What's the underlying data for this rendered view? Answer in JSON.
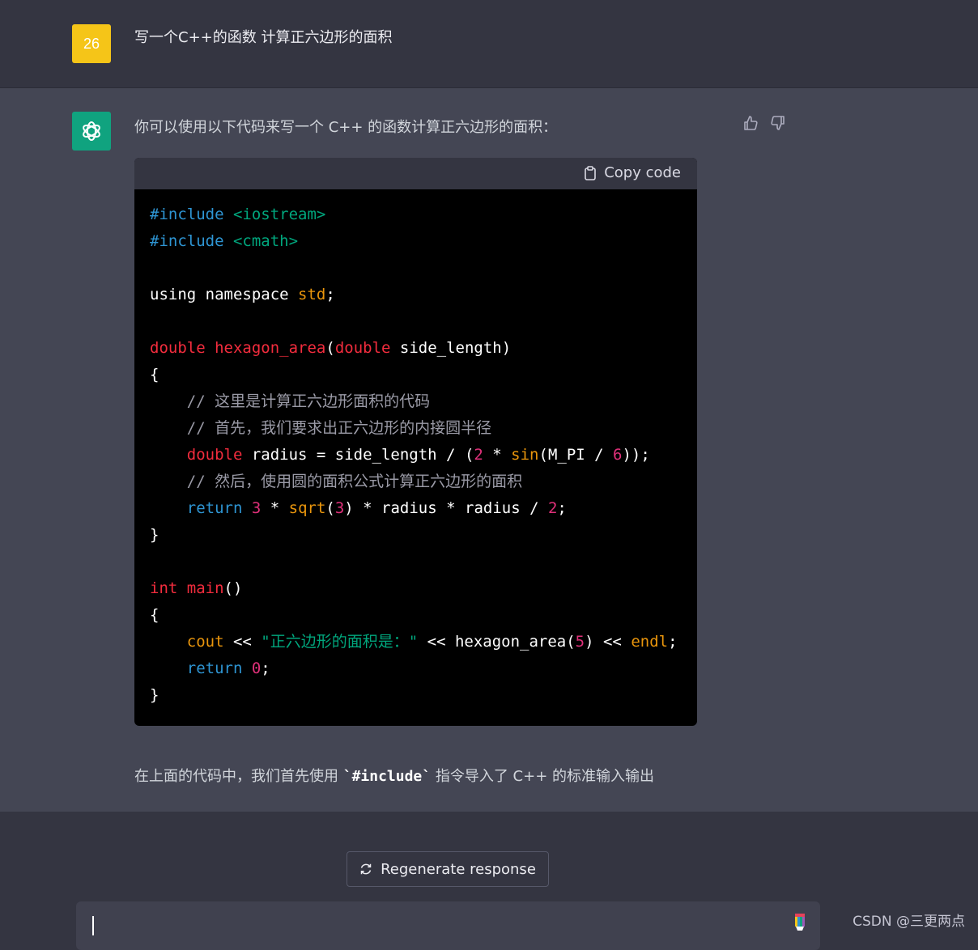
{
  "user_message": {
    "avatar_text": "26",
    "text": "写一个C++的函数 计算正六边形的面积"
  },
  "assistant_message": {
    "avatar_icon": "openai-logo-icon",
    "intro": "你可以使用以下代码来写一个 C++ 的函数计算正六边形的面积：",
    "feedback": {
      "up_icon": "thumbs-up-icon",
      "down_icon": "thumbs-down-icon"
    },
    "code_block": {
      "copy_label": "Copy code",
      "copy_icon": "clipboard-icon",
      "lines": [
        [
          {
            "t": "#include ",
            "c": "t-blue"
          },
          {
            "t": "<iostream>",
            "c": "t-green"
          }
        ],
        [
          {
            "t": "#include ",
            "c": "t-blue"
          },
          {
            "t": "<cmath>",
            "c": "t-green"
          }
        ],
        [],
        [
          {
            "t": "using namespace ",
            "c": "t-white"
          },
          {
            "t": "std",
            "c": "t-orange"
          },
          {
            "t": ";",
            "c": "t-white"
          }
        ],
        [],
        [
          {
            "t": "double ",
            "c": "t-red"
          },
          {
            "t": "hexagon_area",
            "c": "t-red"
          },
          {
            "t": "(",
            "c": "t-white"
          },
          {
            "t": "double ",
            "c": "t-red"
          },
          {
            "t": "side_length)",
            "c": "t-white"
          }
        ],
        [
          {
            "t": "{",
            "c": "t-white"
          }
        ],
        [
          {
            "t": "    // 这里是计算正六边形面积的代码",
            "c": "t-gray"
          }
        ],
        [
          {
            "t": "    // 首先，我们要求出正六边形的内接圆半径",
            "c": "t-gray"
          }
        ],
        [
          {
            "t": "    ",
            "c": "t-white"
          },
          {
            "t": "double ",
            "c": "t-red"
          },
          {
            "t": "radius = side_length / (",
            "c": "t-white"
          },
          {
            "t": "2",
            "c": "t-pink"
          },
          {
            "t": " * ",
            "c": "t-white"
          },
          {
            "t": "sin",
            "c": "t-orange"
          },
          {
            "t": "(M_PI / ",
            "c": "t-white"
          },
          {
            "t": "6",
            "c": "t-pink"
          },
          {
            "t": "));",
            "c": "t-white"
          }
        ],
        [
          {
            "t": "    // 然后，使用圆的面积公式计算正六边形的面积",
            "c": "t-gray"
          }
        ],
        [
          {
            "t": "    ",
            "c": "t-white"
          },
          {
            "t": "return ",
            "c": "t-blue"
          },
          {
            "t": "3",
            "c": "t-pink"
          },
          {
            "t": " * ",
            "c": "t-white"
          },
          {
            "t": "sqrt",
            "c": "t-orange"
          },
          {
            "t": "(",
            "c": "t-white"
          },
          {
            "t": "3",
            "c": "t-pink"
          },
          {
            "t": ") * radius * radius / ",
            "c": "t-white"
          },
          {
            "t": "2",
            "c": "t-pink"
          },
          {
            "t": ";",
            "c": "t-white"
          }
        ],
        [
          {
            "t": "}",
            "c": "t-white"
          }
        ],
        [],
        [
          {
            "t": "int ",
            "c": "t-red"
          },
          {
            "t": "main",
            "c": "t-red"
          },
          {
            "t": "()",
            "c": "t-white"
          }
        ],
        [
          {
            "t": "{",
            "c": "t-white"
          }
        ],
        [
          {
            "t": "    ",
            "c": "t-white"
          },
          {
            "t": "cout",
            "c": "t-orange"
          },
          {
            "t": " << ",
            "c": "t-white"
          },
          {
            "t": "\"正六边形的面积是：\"",
            "c": "t-green"
          },
          {
            "t": " << hexagon_area(",
            "c": "t-white"
          },
          {
            "t": "5",
            "c": "t-pink"
          },
          {
            "t": ") << ",
            "c": "t-white"
          },
          {
            "t": "endl",
            "c": "t-orange"
          },
          {
            "t": ";",
            "c": "t-white"
          }
        ],
        [
          {
            "t": "    ",
            "c": "t-white"
          },
          {
            "t": "return ",
            "c": "t-blue"
          },
          {
            "t": "0",
            "c": "t-pink"
          },
          {
            "t": ";",
            "c": "t-white"
          }
        ],
        [
          {
            "t": "}",
            "c": "t-white"
          }
        ]
      ]
    },
    "outro_before": "在上面的代码中，我们首先使用 ",
    "outro_code": "`#include`",
    "outro_after": " 指令导入了 C++ 的标准输入输出"
  },
  "footer": {
    "regenerate_label": "Regenerate response",
    "regenerate_icon": "refresh-icon",
    "input_value": "",
    "mic_icon": "microphone-icon"
  },
  "watermark": "CSDN @三更两点",
  "colors": {
    "page_bg": "#343541",
    "assistant_bg": "#444654",
    "user_avatar": "#f5c518",
    "bot_avatar": "#10a37f",
    "code_bg": "#000000"
  }
}
